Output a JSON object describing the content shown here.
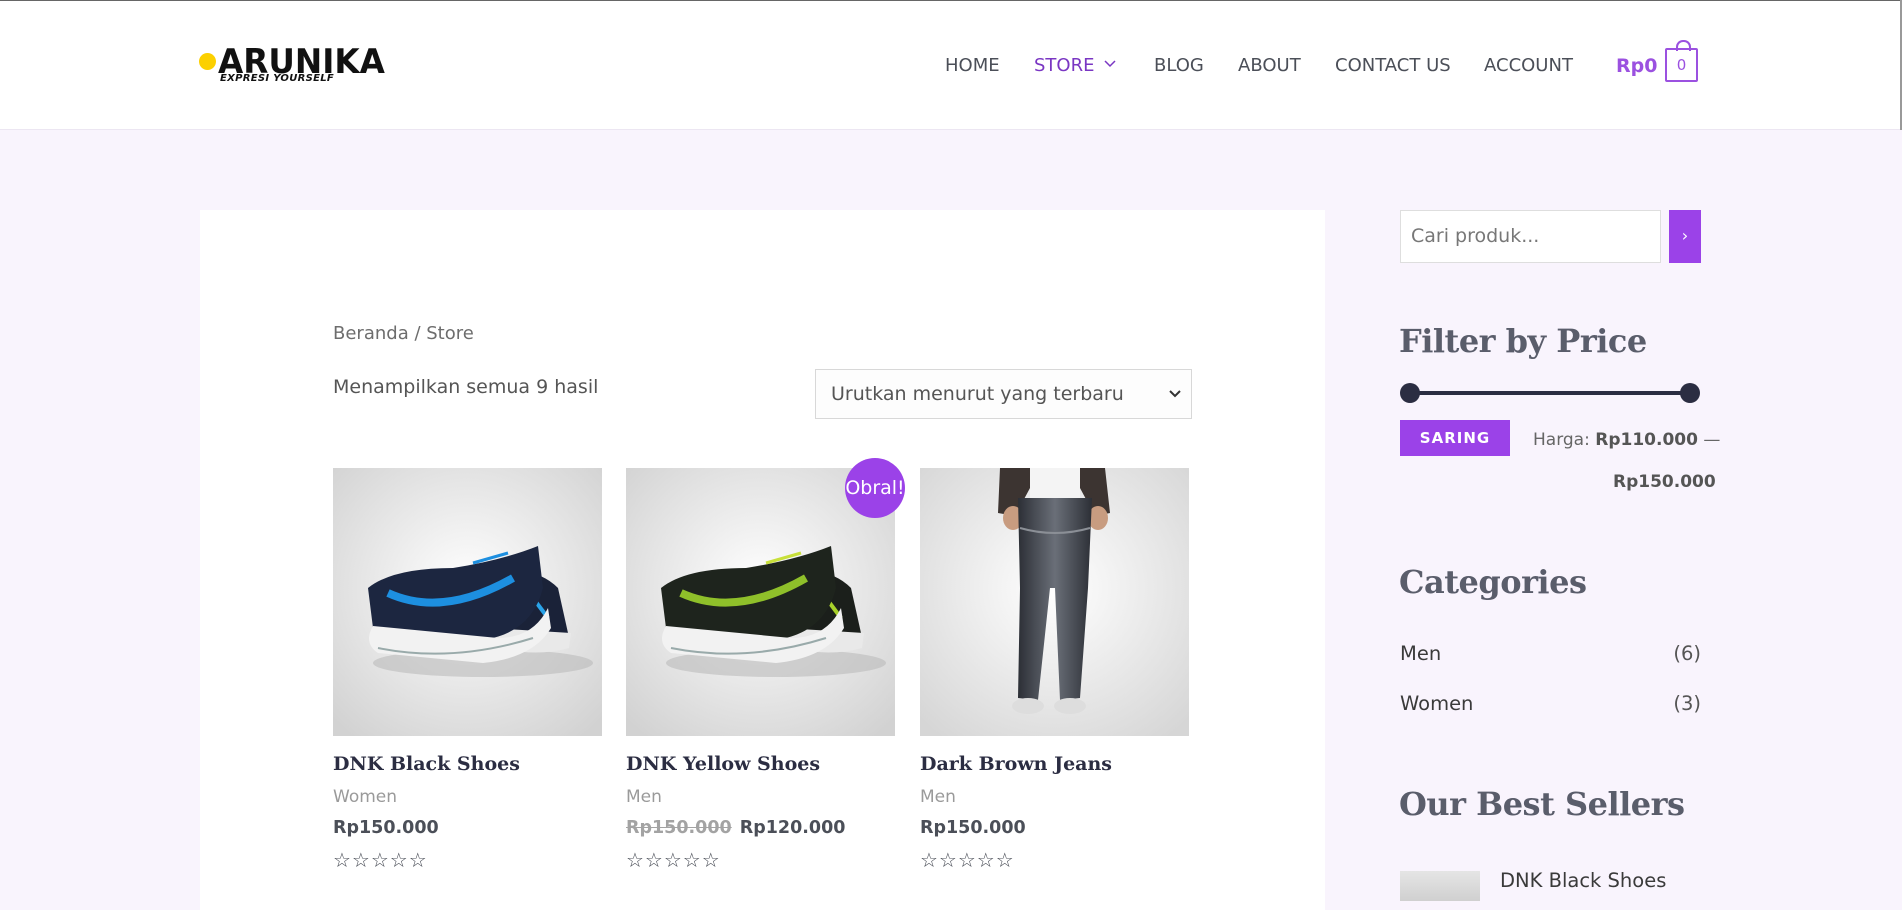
{
  "brand": {
    "logo_text": "ARUNIKA",
    "tagline": "EXPRESI YOURSELF"
  },
  "nav": {
    "items": [
      {
        "label": "HOME"
      },
      {
        "label": "STORE"
      },
      {
        "label": "BLOG"
      },
      {
        "label": "ABOUT"
      },
      {
        "label": "CONTACT US"
      },
      {
        "label": "ACCOUNT"
      }
    ],
    "cart_total": "Rp0",
    "cart_count": "0"
  },
  "colors": {
    "accent": "#9b42e8",
    "page_background": "#f9f4fd",
    "logo_dot": "#fcd000"
  },
  "shop": {
    "breadcrumb": "Beranda / Store",
    "result_count": "Menampilkan semua 9 hasil",
    "sort_selected": "Urutkan menurut yang terbaru",
    "sale_badge": "Obral!",
    "products": [
      {
        "name": "DNK Black Shoes",
        "category": "Women",
        "old_price": "",
        "price": "Rp150.000",
        "rating_stars": "☆☆☆☆☆",
        "image": "black-blue-sneakers"
      },
      {
        "name": "DNK Yellow Shoes",
        "category": "Men",
        "old_price": "Rp150.000",
        "price": "Rp120.000",
        "rating_stars": "☆☆☆☆☆",
        "image": "black-yellow-sneakers"
      },
      {
        "name": "Dark Brown Jeans",
        "category": "Men",
        "old_price": "",
        "price": "Rp150.000",
        "rating_stars": "☆☆☆☆☆",
        "image": "jeans-model"
      }
    ]
  },
  "sidebar": {
    "search_placeholder": "Cari produk...",
    "search_button": "›",
    "filter_title": "Filter by Price",
    "filter_button": "SARING",
    "price_label": "Harga:",
    "price_min": "Rp110.000",
    "price_sep": "—",
    "price_max": "Rp150.000",
    "categories_title": "Categories",
    "categories": [
      {
        "name": "Men",
        "count": "(6)"
      },
      {
        "name": "Women",
        "count": "(3)"
      }
    ],
    "bestsellers_title": "Our Best Sellers",
    "bestsellers": [
      {
        "name": "DNK Black Shoes"
      }
    ]
  }
}
